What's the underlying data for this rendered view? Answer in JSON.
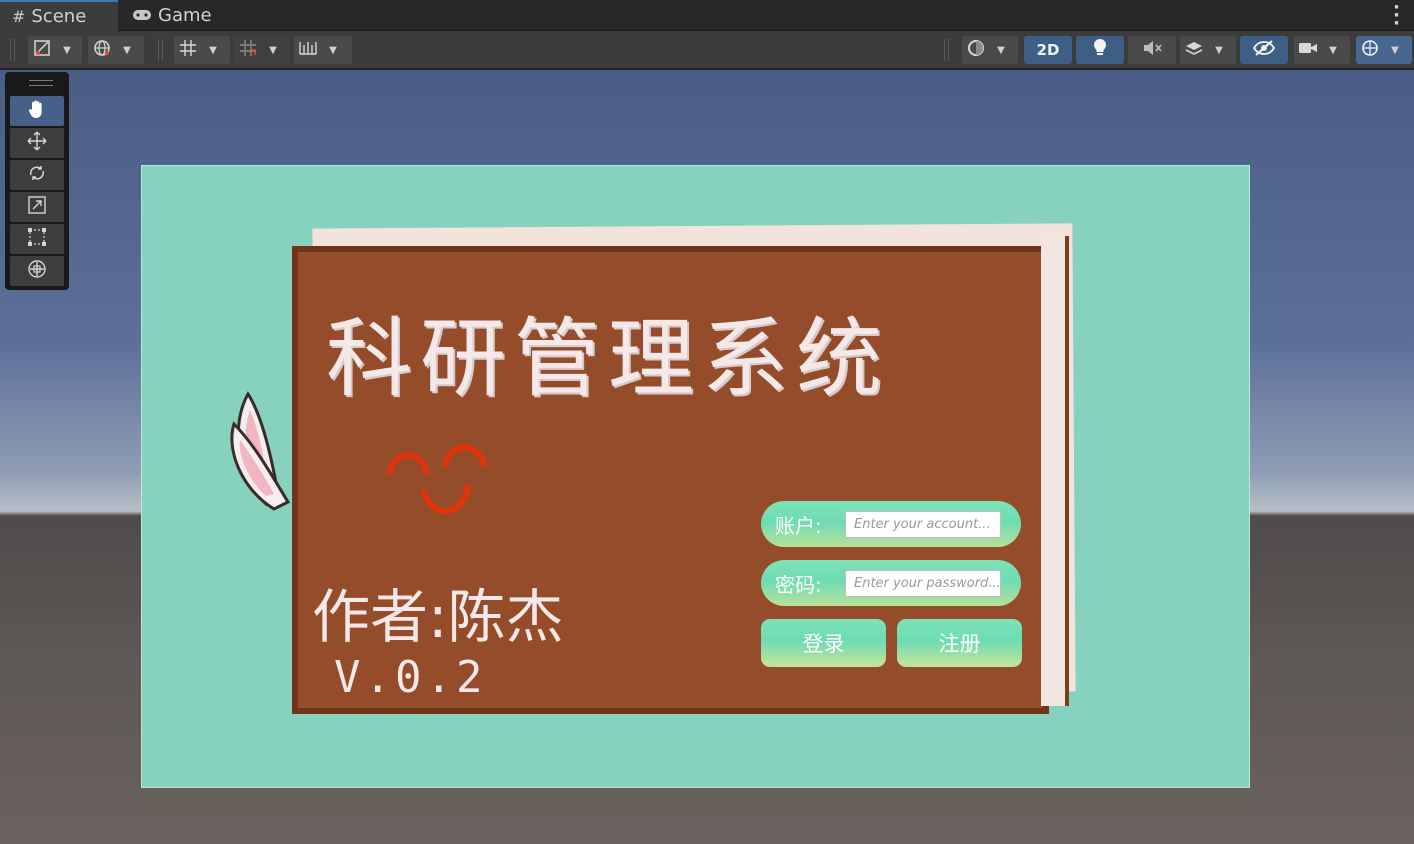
{
  "tabs": [
    {
      "label": "Scene",
      "icon": "grid-hash-icon",
      "active": true
    },
    {
      "label": "Game",
      "icon": "gamepad-icon",
      "active": false
    }
  ],
  "toolbar": {
    "toggle_2d_label": "2D"
  },
  "game": {
    "title": "科研管理系统",
    "author": "作者:陈杰",
    "version": "V.0.2",
    "account_label": "账户:",
    "account_placeholder": "Enter your account...",
    "password_label": "密码:",
    "password_placeholder": "Enter your password...",
    "login_label": "登录",
    "register_label": "注册"
  },
  "colors": {
    "canvas_bg": "#87d2bf",
    "board": "#944c2a",
    "accent_blue": "#3d5f86",
    "smile": "#e0340d"
  }
}
